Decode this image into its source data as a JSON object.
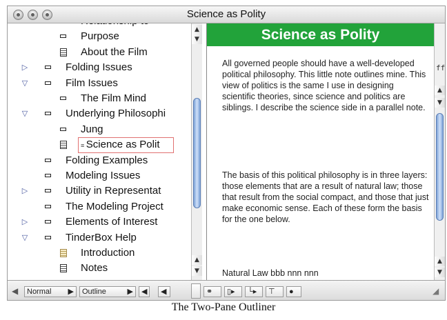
{
  "window": {
    "title": "Science as Polity"
  },
  "outline": {
    "rows": [
      {
        "label": "Relationship to",
        "level": 2,
        "icon": "note",
        "expander": "none"
      },
      {
        "label": "Purpose",
        "level": 2,
        "icon": "note",
        "expander": "none"
      },
      {
        "label": "About the Film",
        "level": 2,
        "icon": "doc",
        "expander": "none"
      },
      {
        "label": "Folding Issues",
        "level": 1,
        "icon": "note",
        "expander": "collapsed"
      },
      {
        "label": "Film Issues",
        "level": 1,
        "icon": "note",
        "expander": "expanded"
      },
      {
        "label": "The Film Mind",
        "level": 2,
        "icon": "note",
        "expander": "none"
      },
      {
        "label": "Underlying Philosophi",
        "level": 1,
        "icon": "note",
        "expander": "expanded"
      },
      {
        "label": "Jung",
        "level": 2,
        "icon": "note",
        "expander": "none"
      },
      {
        "label": "Science as Polit",
        "level": 2,
        "icon": "doc",
        "expander": "none",
        "selected": true
      },
      {
        "label": "Folding Examples",
        "level": 1,
        "icon": "note",
        "expander": "none"
      },
      {
        "label": "Modeling Issues",
        "level": 1,
        "icon": "note",
        "expander": "none"
      },
      {
        "label": "Utility in Representat",
        "level": 1,
        "icon": "note",
        "expander": "collapsed"
      },
      {
        "label": "The Modeling Project",
        "level": 1,
        "icon": "note",
        "expander": "none"
      },
      {
        "label": "Elements of Interest",
        "level": 1,
        "icon": "note",
        "expander": "collapsed"
      },
      {
        "label": "TinderBox Help",
        "level": 1,
        "icon": "note",
        "expander": "expanded"
      },
      {
        "label": "Introduction",
        "level": 2,
        "icon": "doc-tan",
        "expander": "none"
      },
      {
        "label": "Notes",
        "level": 2,
        "icon": "doc",
        "expander": "none"
      }
    ]
  },
  "note": {
    "title": "Science as Polity",
    "paragraph1": "All governed people should have a well-developed political philosophy. This little note outlines mine. This view of politics is the same I use in designing scientific theories, since science and politics are siblings. I describe the science side in a parallel note.",
    "paragraph2": "The basis of this political philosophy is in three layers: those elements that are a result of natural law; those that result from the social compact, and those that just make economic sense. Each of these form the basis for the one below.",
    "paragraph3": "Natural Law  bbb  nnn nnn"
  },
  "bottombar": {
    "normal_label": "Normal",
    "outline_label": "Outline"
  },
  "caption": "The Two-Pane Outliner",
  "colors": {
    "title_green": "#22a33a",
    "selection_outline": "#e07070"
  }
}
